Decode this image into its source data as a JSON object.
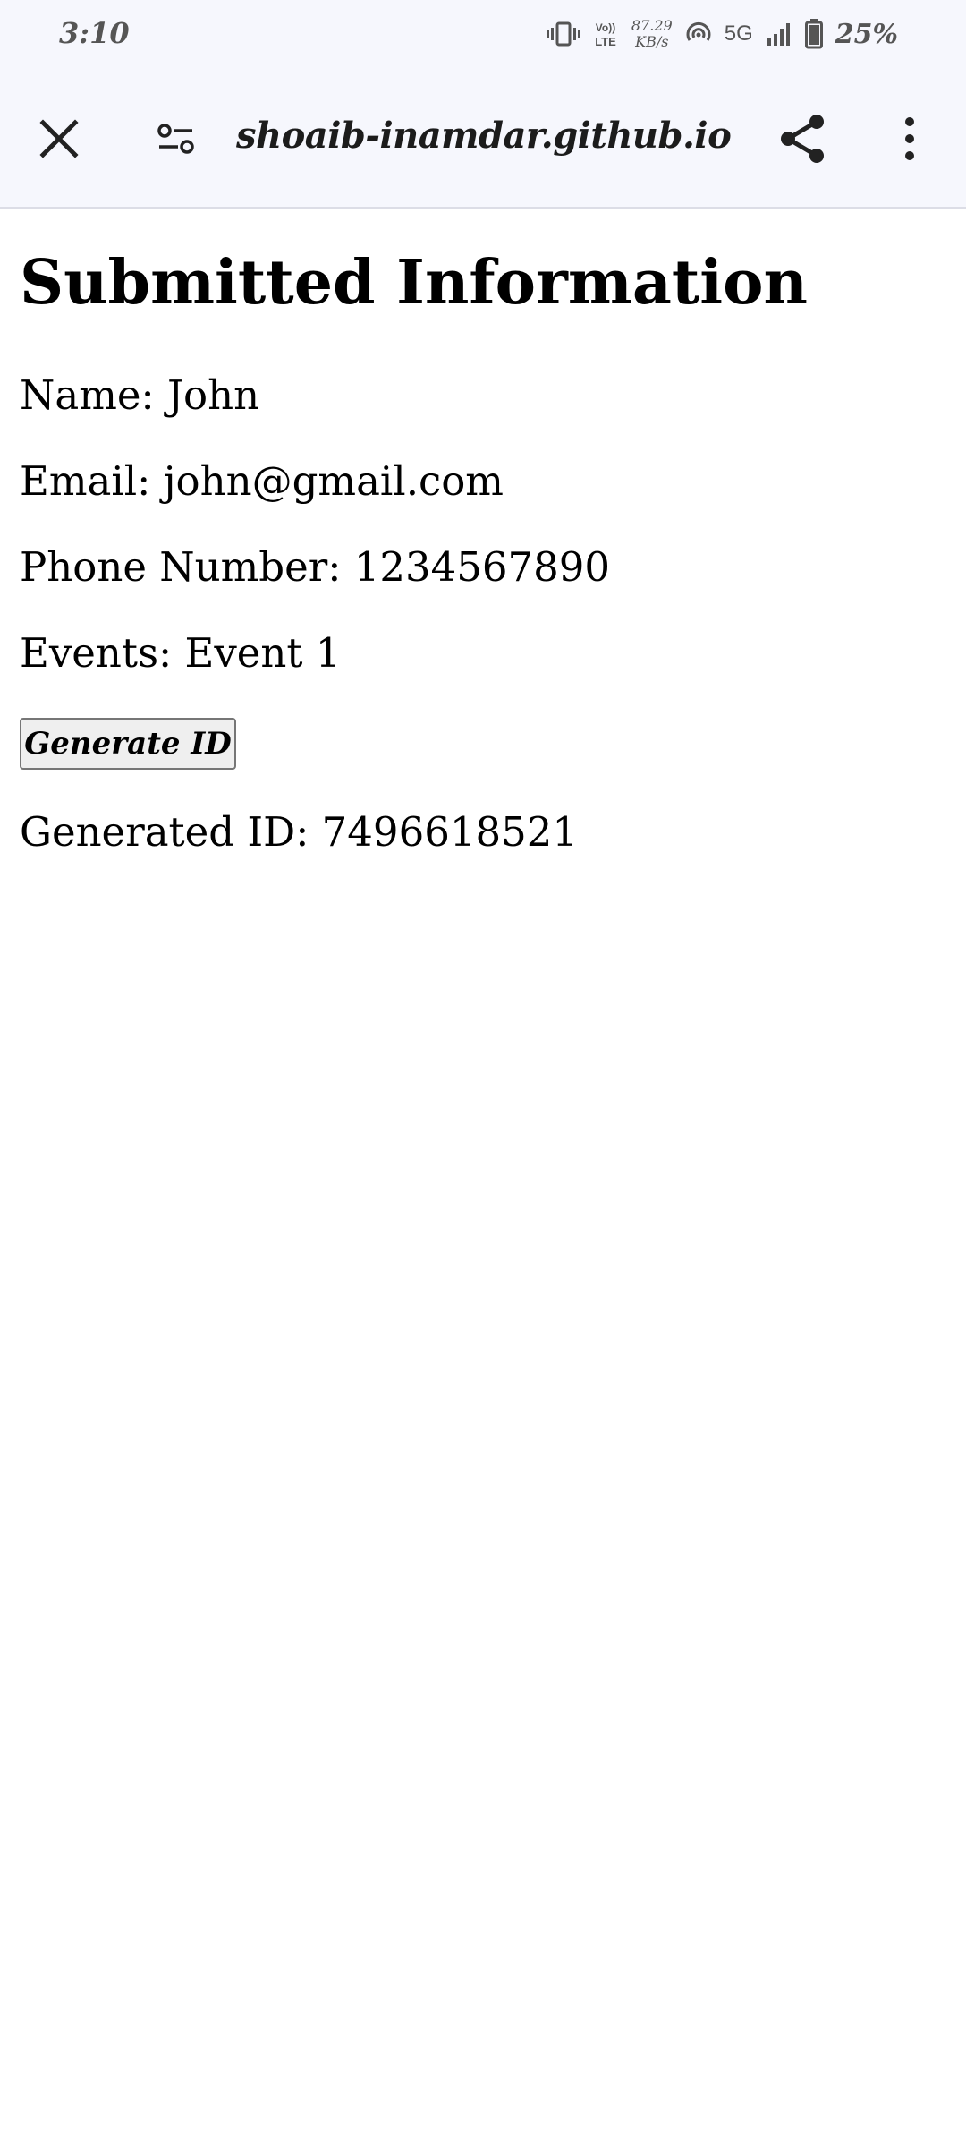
{
  "status_bar": {
    "time": "3:10",
    "net_speed_value": "87.29",
    "net_speed_unit": "KB/s",
    "network": "5G",
    "battery": "25%",
    "icons": [
      "vibrate-icon",
      "volte-icon",
      "hotspot-icon",
      "signal-icon",
      "battery-icon"
    ]
  },
  "toolbar": {
    "url": "shoaib-inamdar.github.io",
    "icons": [
      "close-icon",
      "site-settings-icon",
      "share-icon",
      "more-menu-icon"
    ]
  },
  "page": {
    "title": "Submitted Information",
    "name_line": "Name: John",
    "email_line": "Email: john@gmail.com",
    "phone_line": "Phone Number: 1234567890",
    "events_line": "Events: Event 1",
    "generate_button_label": "Generate ID",
    "generated_id_line": "Generated ID: 7496618521"
  }
}
